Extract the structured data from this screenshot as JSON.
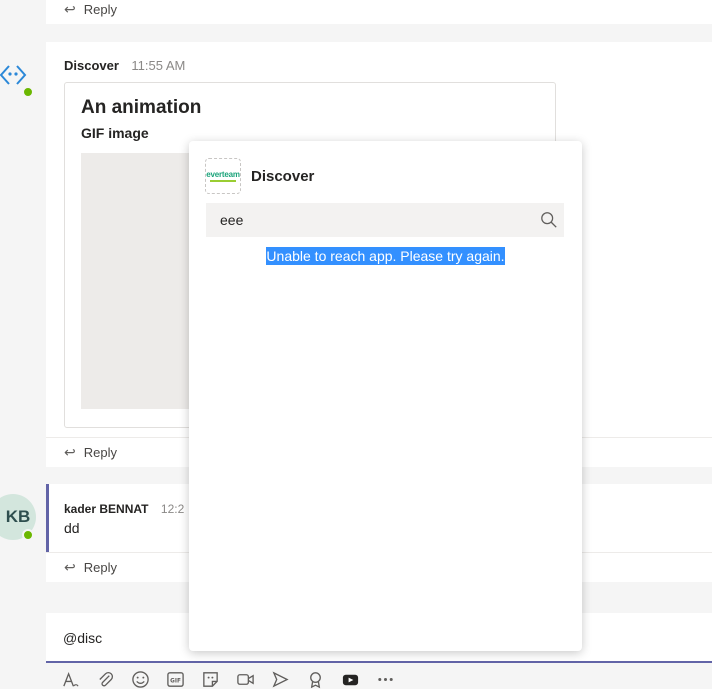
{
  "reply_label": "Reply",
  "bot_message": {
    "sender": "Discover",
    "time": "11:55 AM",
    "card_title": "An animation",
    "card_subtitle": "GIF image"
  },
  "user_message": {
    "avatar_initials": "KB",
    "sender": "kader BENNAT",
    "time": "12:2",
    "text": "dd"
  },
  "compose": {
    "text": "@disc"
  },
  "popup": {
    "logo_text": "everteam",
    "title": "Discover",
    "search_value": "eee",
    "error_text": "Unable to reach app. Please try again."
  },
  "toolbar_icons": [
    "format-icon",
    "attach-icon",
    "emoji-icon",
    "gif-icon",
    "sticker-icon",
    "meet-icon",
    "stream-icon",
    "praise-icon",
    "youtube-icon",
    "more-icon"
  ],
  "colors": {
    "accent": "#6264a7",
    "presence": "#6bb700",
    "selection": "#3390ff"
  }
}
